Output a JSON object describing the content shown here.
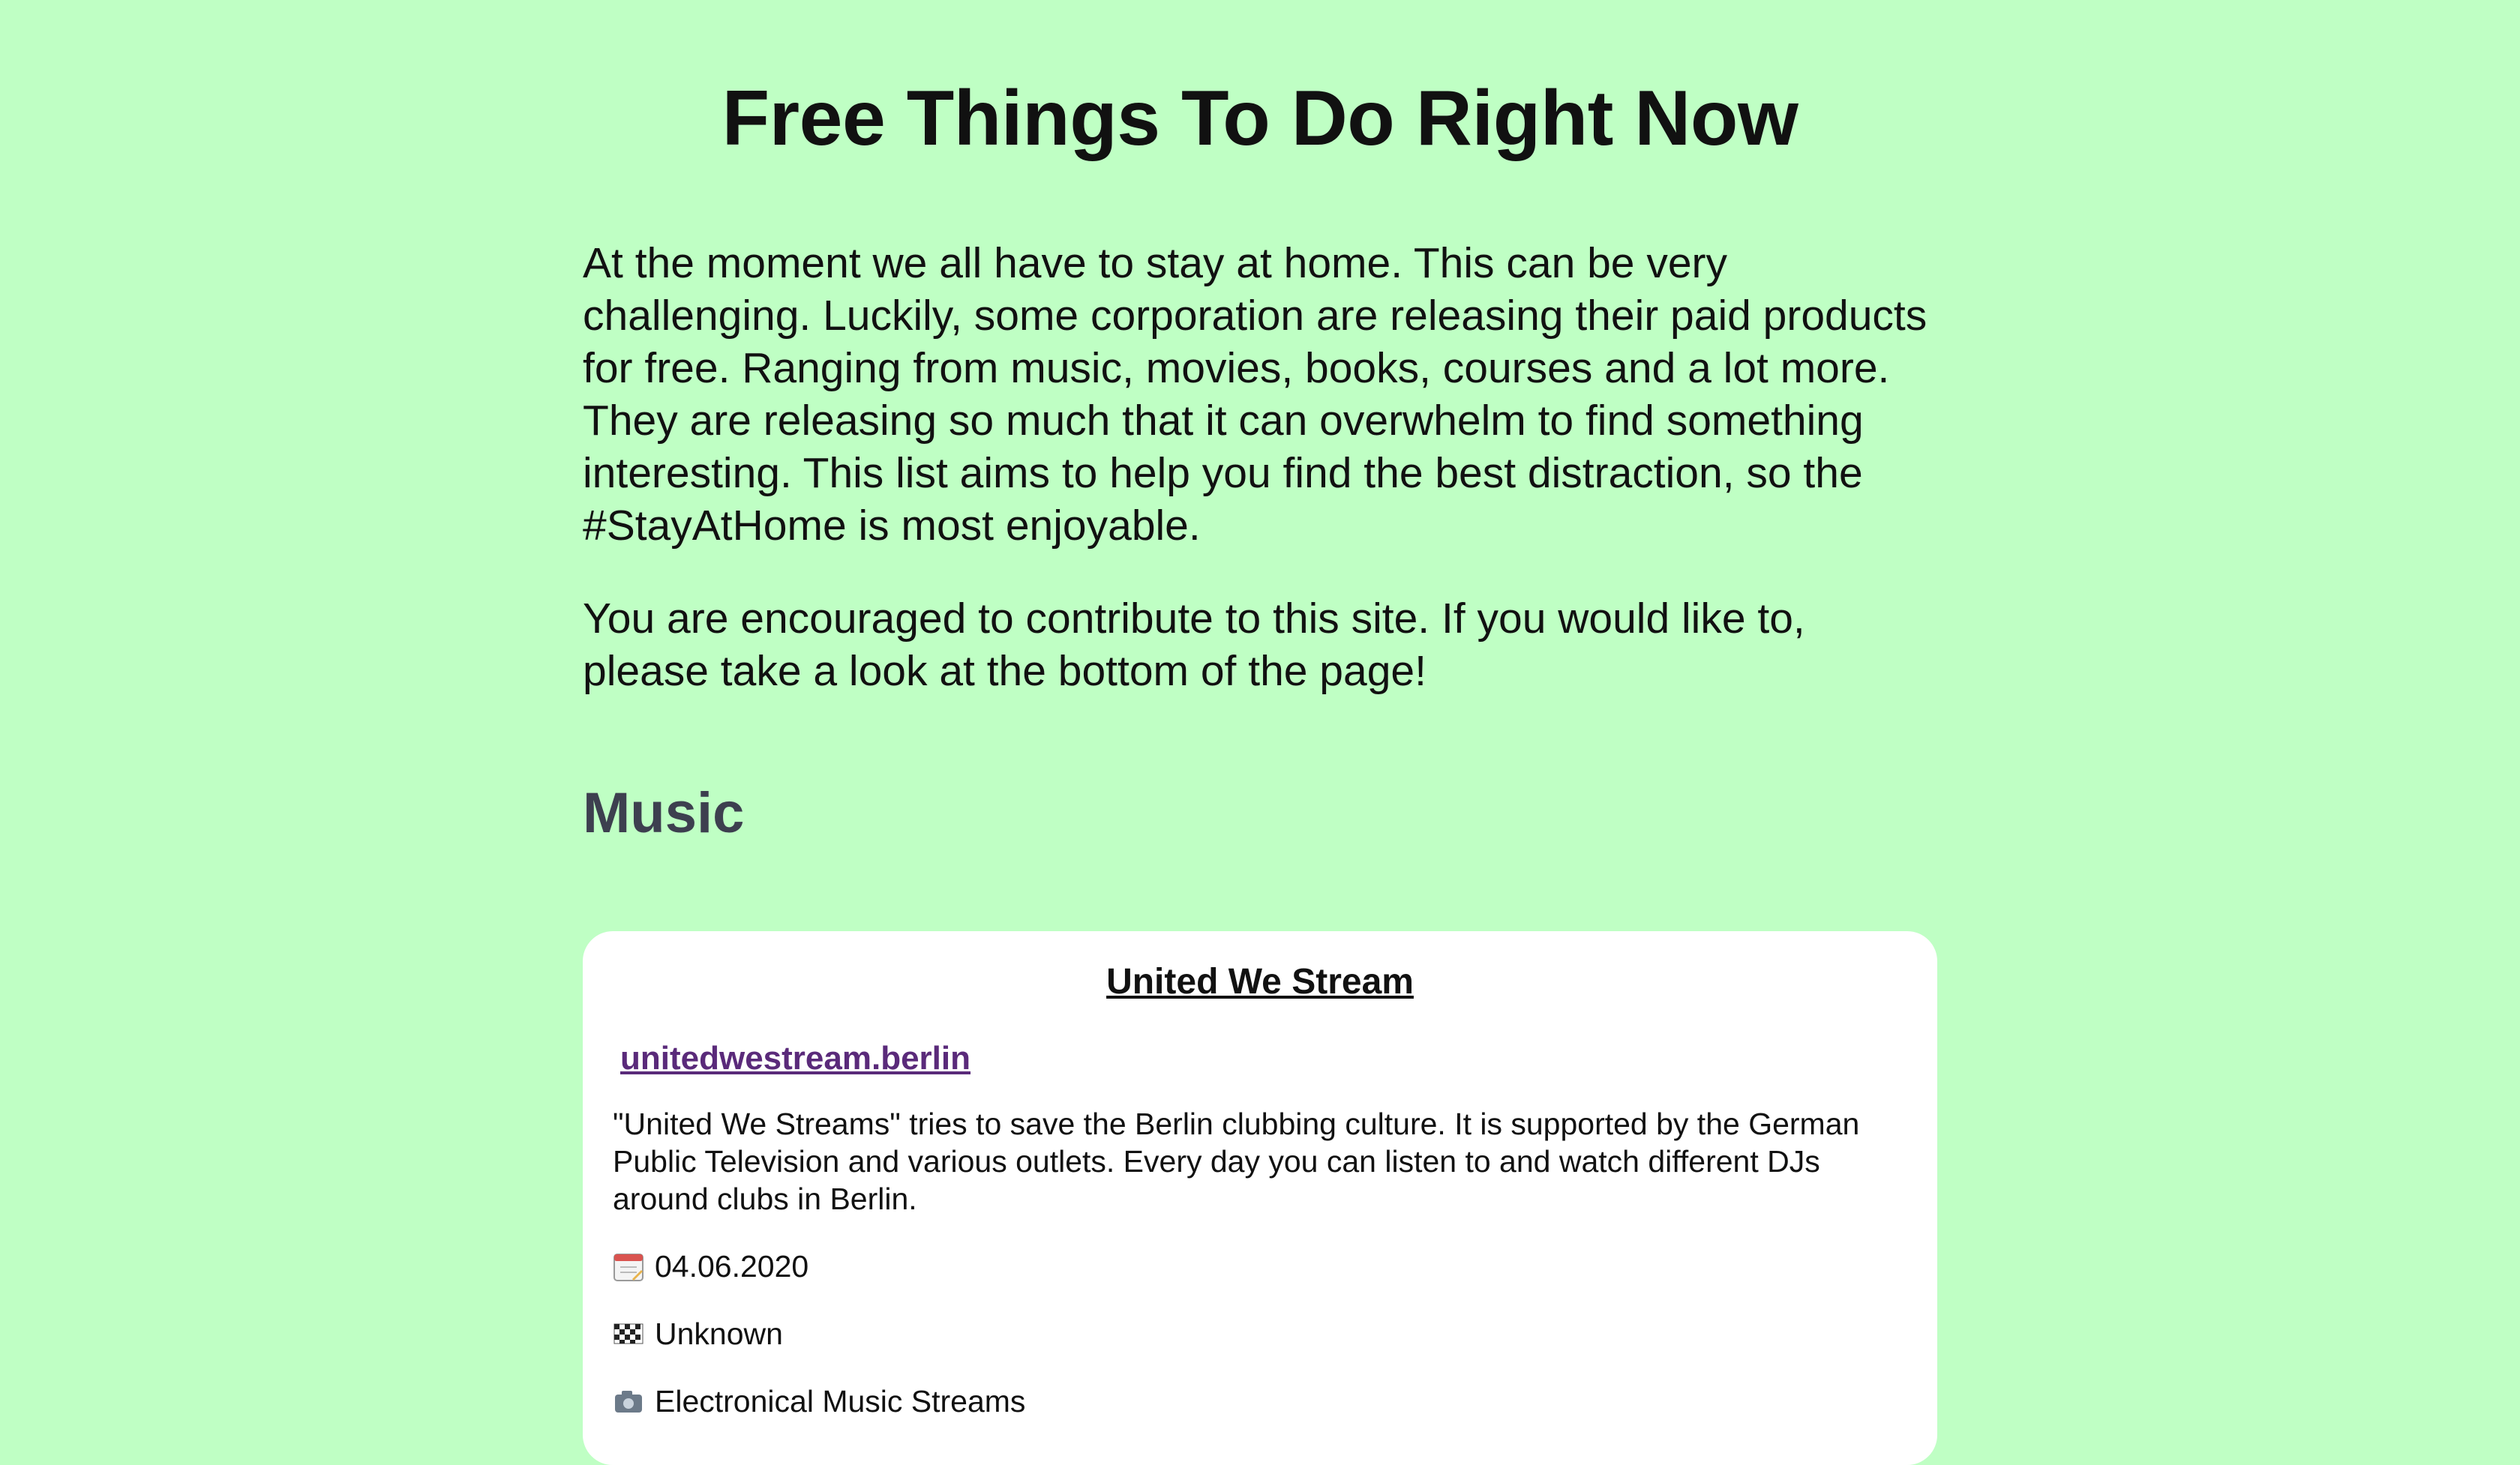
{
  "page": {
    "title": "Free Things To Do Right Now",
    "intro_paragraphs": [
      "At the moment we all have to stay at home. This can be very challenging. Luckily, some corporation are releasing their paid products for free. Ranging from music, movies, books, courses and a lot more. They are releasing so much that it can overwhelm to find something interesting. This list aims to help you find the best distraction, so the #StayAtHome is most enjoyable.",
      "You are encouraged to contribute to this site. If you would like to, please take a look at the bottom of the page!"
    ]
  },
  "sections": [
    {
      "title": "Music",
      "cards": [
        {
          "title": "United We Stream",
          "link_text": "unitedwestream.berlin",
          "description": "\"United We Streams\" tries to save the Berlin clubbing culture. It is supported by the German Public Television and various outlets. Every day you can listen to and watch different DJs around clubs in Berlin.",
          "date": "04.06.2020",
          "end": "Unknown",
          "category": "Electronical Music Streams",
          "icons": {
            "date": "calendar-icon",
            "end": "checkered-flag-icon",
            "category": "camera-icon"
          }
        }
      ]
    }
  ]
}
